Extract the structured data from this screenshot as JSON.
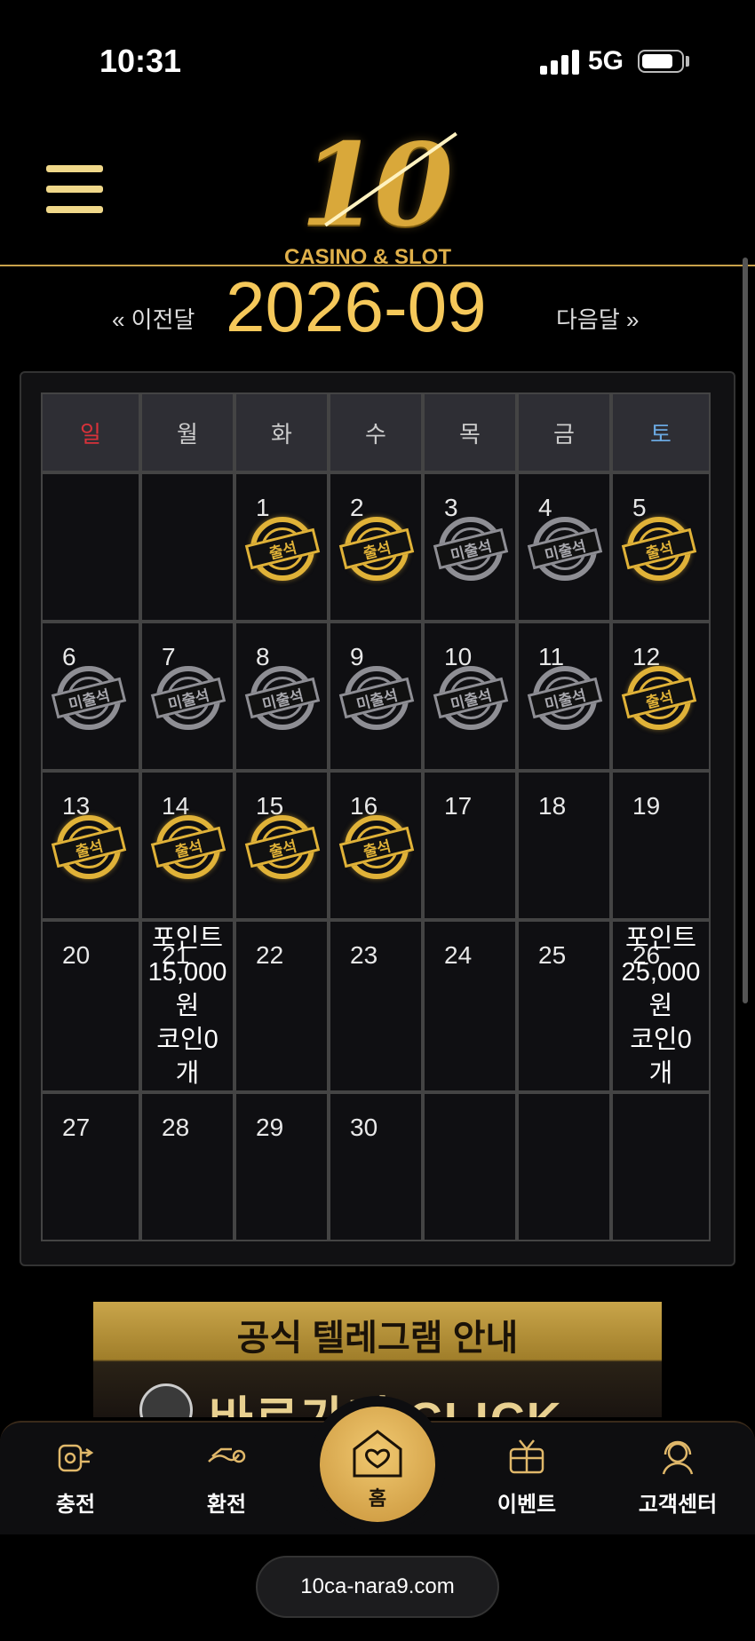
{
  "status_bar": {
    "time": "10:31",
    "network": "5G"
  },
  "header": {
    "logo_number": "10",
    "logo_text": "CASINO & SLOT"
  },
  "month_nav": {
    "prev_label": "« 이전달",
    "title": "2026-09",
    "next_label": "다음달 »"
  },
  "calendar": {
    "weekdays": [
      "일",
      "월",
      "화",
      "수",
      "목",
      "금",
      "토"
    ],
    "weekday_colors": {
      "sunday": "#d8323a",
      "weekday": "#cccccc",
      "saturday": "#6aa8e0"
    },
    "stamp_labels": {
      "attended": "출석",
      "absent": "미출석"
    },
    "weeks": [
      [
        {
          "day": "",
          "stamp": ""
        },
        {
          "day": "",
          "stamp": ""
        },
        {
          "day": "1",
          "stamp": "attended"
        },
        {
          "day": "2",
          "stamp": "attended"
        },
        {
          "day": "3",
          "stamp": "absent"
        },
        {
          "day": "4",
          "stamp": "absent"
        },
        {
          "day": "5",
          "stamp": "attended"
        }
      ],
      [
        {
          "day": "6",
          "stamp": "absent"
        },
        {
          "day": "7",
          "stamp": "absent"
        },
        {
          "day": "8",
          "stamp": "absent"
        },
        {
          "day": "9",
          "stamp": "absent"
        },
        {
          "day": "10",
          "stamp": "absent"
        },
        {
          "day": "11",
          "stamp": "absent"
        },
        {
          "day": "12",
          "stamp": "attended"
        }
      ],
      [
        {
          "day": "13",
          "stamp": "attended"
        },
        {
          "day": "14",
          "stamp": "attended"
        },
        {
          "day": "15",
          "stamp": "attended"
        },
        {
          "day": "16",
          "stamp": "attended"
        },
        {
          "day": "17",
          "stamp": ""
        },
        {
          "day": "18",
          "stamp": ""
        },
        {
          "day": "19",
          "stamp": ""
        }
      ],
      [
        {
          "day": "20",
          "stamp": ""
        },
        {
          "day": "21",
          "stamp": "",
          "reward": [
            "포인트",
            "15,000",
            "원",
            "코인0",
            "개"
          ]
        },
        {
          "day": "22",
          "stamp": ""
        },
        {
          "day": "23",
          "stamp": ""
        },
        {
          "day": "24",
          "stamp": ""
        },
        {
          "day": "25",
          "stamp": ""
        },
        {
          "day": "26",
          "stamp": "",
          "reward": [
            "포인트",
            "25,000",
            "원",
            "코인0",
            "개"
          ]
        }
      ],
      [
        {
          "day": "27",
          "stamp": ""
        },
        {
          "day": "28",
          "stamp": ""
        },
        {
          "day": "29",
          "stamp": ""
        },
        {
          "day": "30",
          "stamp": ""
        },
        {
          "day": "",
          "stamp": ""
        },
        {
          "day": "",
          "stamp": ""
        },
        {
          "day": "",
          "stamp": ""
        }
      ]
    ]
  },
  "banner": {
    "title": "공식 텔레그램 안내",
    "subtitle": "바로가기 CLICK"
  },
  "bottom_nav": {
    "items": [
      {
        "label": "충전",
        "icon": "deposit-icon"
      },
      {
        "label": "환전",
        "icon": "withdraw-icon"
      },
      {
        "label": "홈",
        "icon": "home-heart-icon"
      },
      {
        "label": "이벤트",
        "icon": "gift-icon"
      },
      {
        "label": "고객센터",
        "icon": "support-icon"
      }
    ]
  },
  "url_bar": {
    "url": "10ca-nara9.com"
  },
  "colors": {
    "gold": "#f5c85a",
    "background": "#000000",
    "panel": "#111113"
  }
}
